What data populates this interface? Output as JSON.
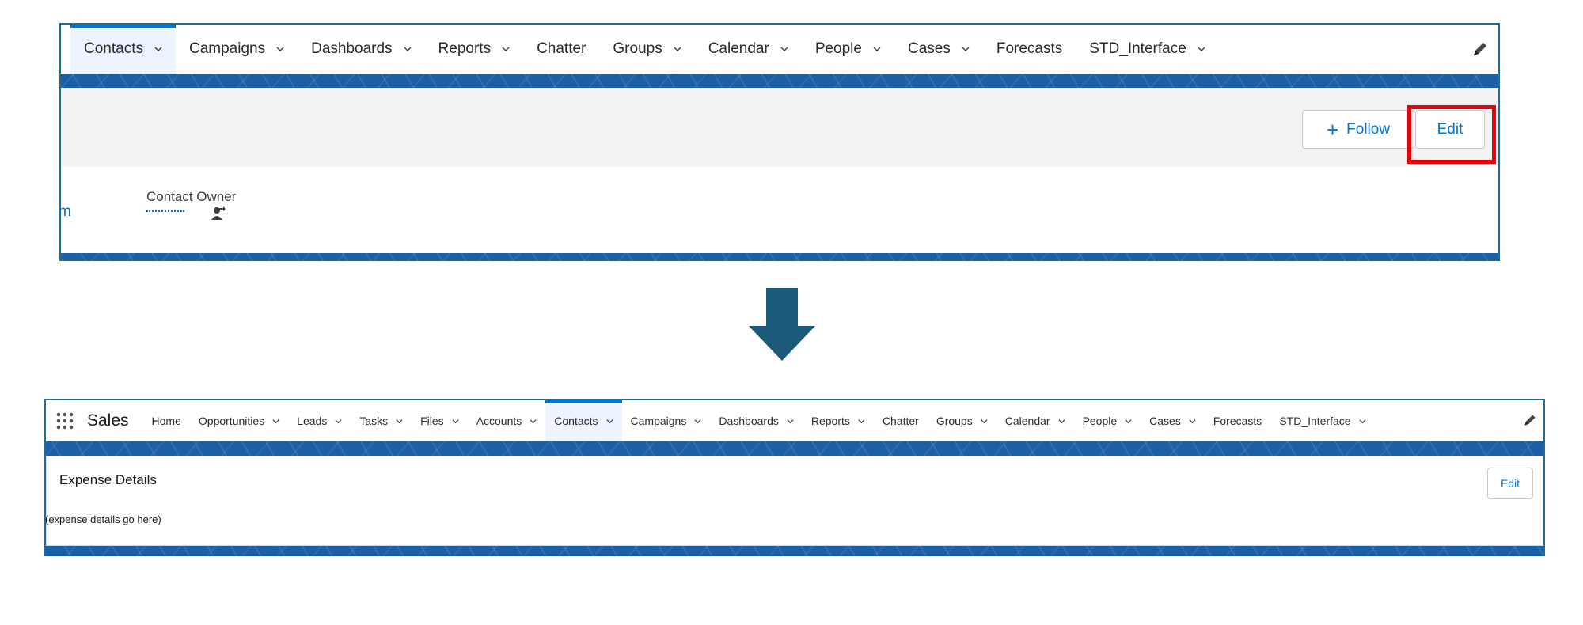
{
  "top_panel": {
    "tabs": [
      {
        "label": "Contacts",
        "dropdown": true,
        "active": true
      },
      {
        "label": "Campaigns",
        "dropdown": true
      },
      {
        "label": "Dashboards",
        "dropdown": true
      },
      {
        "label": "Reports",
        "dropdown": true
      },
      {
        "label": "Chatter",
        "dropdown": false
      },
      {
        "label": "Groups",
        "dropdown": true
      },
      {
        "label": "Calendar",
        "dropdown": true
      },
      {
        "label": "People",
        "dropdown": true
      },
      {
        "label": "Cases",
        "dropdown": true
      },
      {
        "label": "Forecasts",
        "dropdown": false
      },
      {
        "label": "STD_Interface",
        "dropdown": true
      }
    ],
    "follow_label": "Follow",
    "edit_label": "Edit",
    "contact_owner_label": "Contact Owner",
    "cropped_text": "m",
    "highlight_color": "#e8000b"
  },
  "bottom_panel": {
    "app_name": "Sales",
    "tabs": [
      {
        "label": "Home",
        "dropdown": false
      },
      {
        "label": "Opportunities",
        "dropdown": true
      },
      {
        "label": "Leads",
        "dropdown": true
      },
      {
        "label": "Tasks",
        "dropdown": true
      },
      {
        "label": "Files",
        "dropdown": true
      },
      {
        "label": "Accounts",
        "dropdown": true
      },
      {
        "label": "Contacts",
        "dropdown": true,
        "active": true
      },
      {
        "label": "Campaigns",
        "dropdown": true
      },
      {
        "label": "Dashboards",
        "dropdown": true
      },
      {
        "label": "Reports",
        "dropdown": true
      },
      {
        "label": "Chatter",
        "dropdown": false
      },
      {
        "label": "Groups",
        "dropdown": true
      },
      {
        "label": "Calendar",
        "dropdown": true
      },
      {
        "label": "People",
        "dropdown": true
      },
      {
        "label": "Cases",
        "dropdown": true
      },
      {
        "label": "Forecasts",
        "dropdown": false
      },
      {
        "label": "STD_Interface",
        "dropdown": true
      }
    ],
    "card_title": "Expense Details",
    "card_body": "(expense details go here)",
    "edit_label": "Edit"
  },
  "colors": {
    "brand_blue": "#0176d3",
    "band_blue": "#1b5fa6",
    "arrow": "#1b5a78",
    "panel_border": "#1f6d97"
  },
  "icons": {
    "edit_nav": "pencil-icon",
    "chevron": "chevron-down-icon",
    "owner_change": "change-owner-icon",
    "app_launcher": "app-launcher-icon",
    "flow": "down-arrow-icon"
  }
}
